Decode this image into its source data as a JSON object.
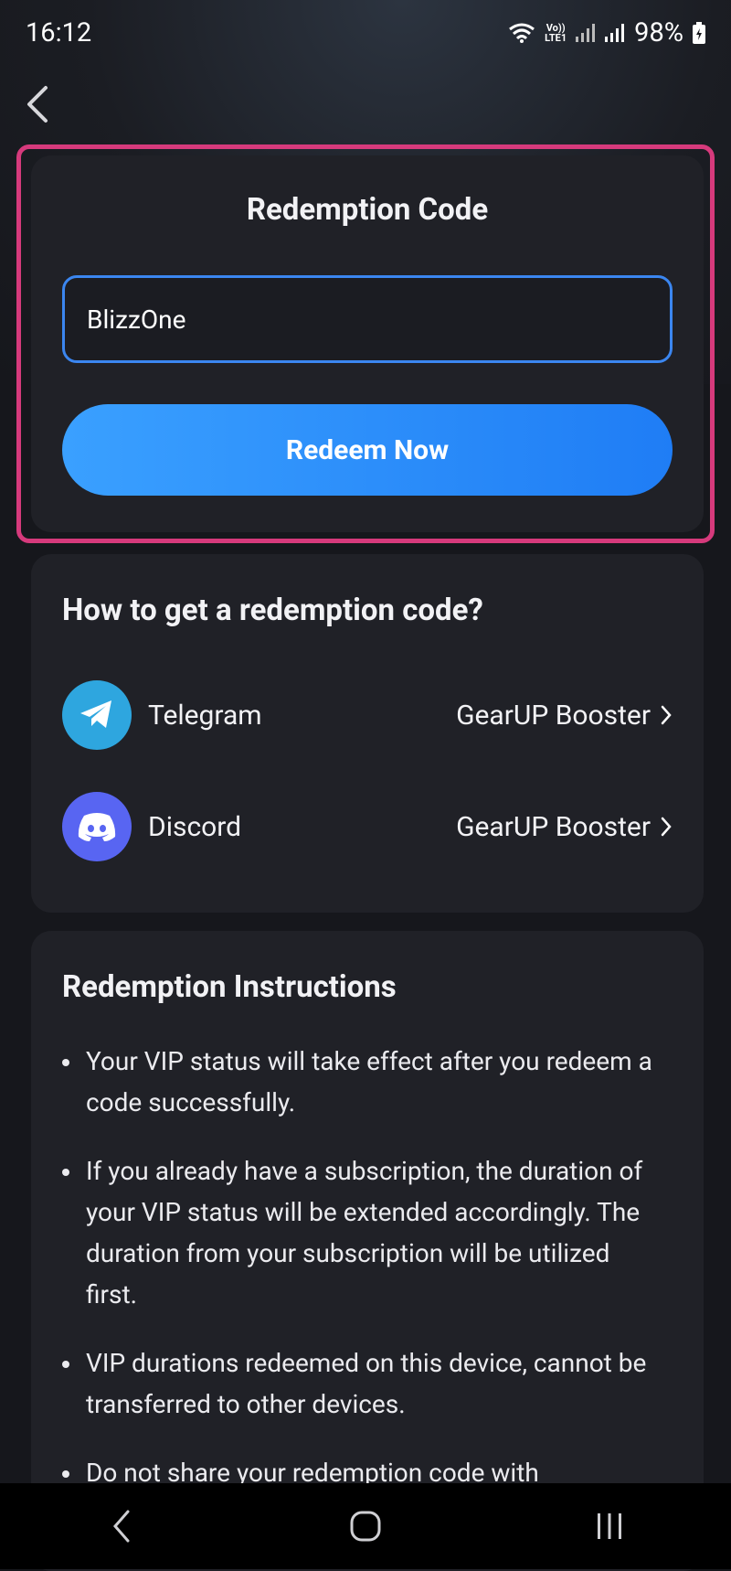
{
  "status_bar": {
    "time": "16:12",
    "volte_line1": "Vo))",
    "volte_line2": "LTE1",
    "battery": "98%",
    "icons": [
      "wifi-icon",
      "signal-icon",
      "battery-icon"
    ]
  },
  "header": {
    "back_icon": "chevron-left-icon"
  },
  "redeem_card": {
    "title": "Redemption Code",
    "input_value": "BlizzOne",
    "button_label": "Redeem Now",
    "highlight_color": "#d63a7c"
  },
  "get_code_card": {
    "title": "How to get a redemption code?",
    "channels": [
      {
        "name": "Telegram",
        "link": "GearUP Booster",
        "icon": "telegram-icon",
        "color": "#2ea6df"
      },
      {
        "name": "Discord",
        "link": "GearUP Booster",
        "icon": "discord-icon",
        "color": "#5865f2"
      }
    ]
  },
  "instructions_card": {
    "title": "Redemption Instructions",
    "items": [
      "Your VIP status will take effect after you redeem a code successfully.",
      "If you already have a subscription, the duration of your VIP status will be extended accordingly. The duration from your subscription will be utilized first.",
      "VIP durations redeemed on this device, cannot be transferred to other devices.",
      "Do not share your redemption code with"
    ]
  },
  "nav_bar": {
    "icons": [
      "back-nav-icon",
      "home-nav-icon",
      "recents-nav-icon"
    ]
  },
  "colors": {
    "accent": "#1f7df5",
    "background": "#16171c",
    "card": "#202127"
  }
}
